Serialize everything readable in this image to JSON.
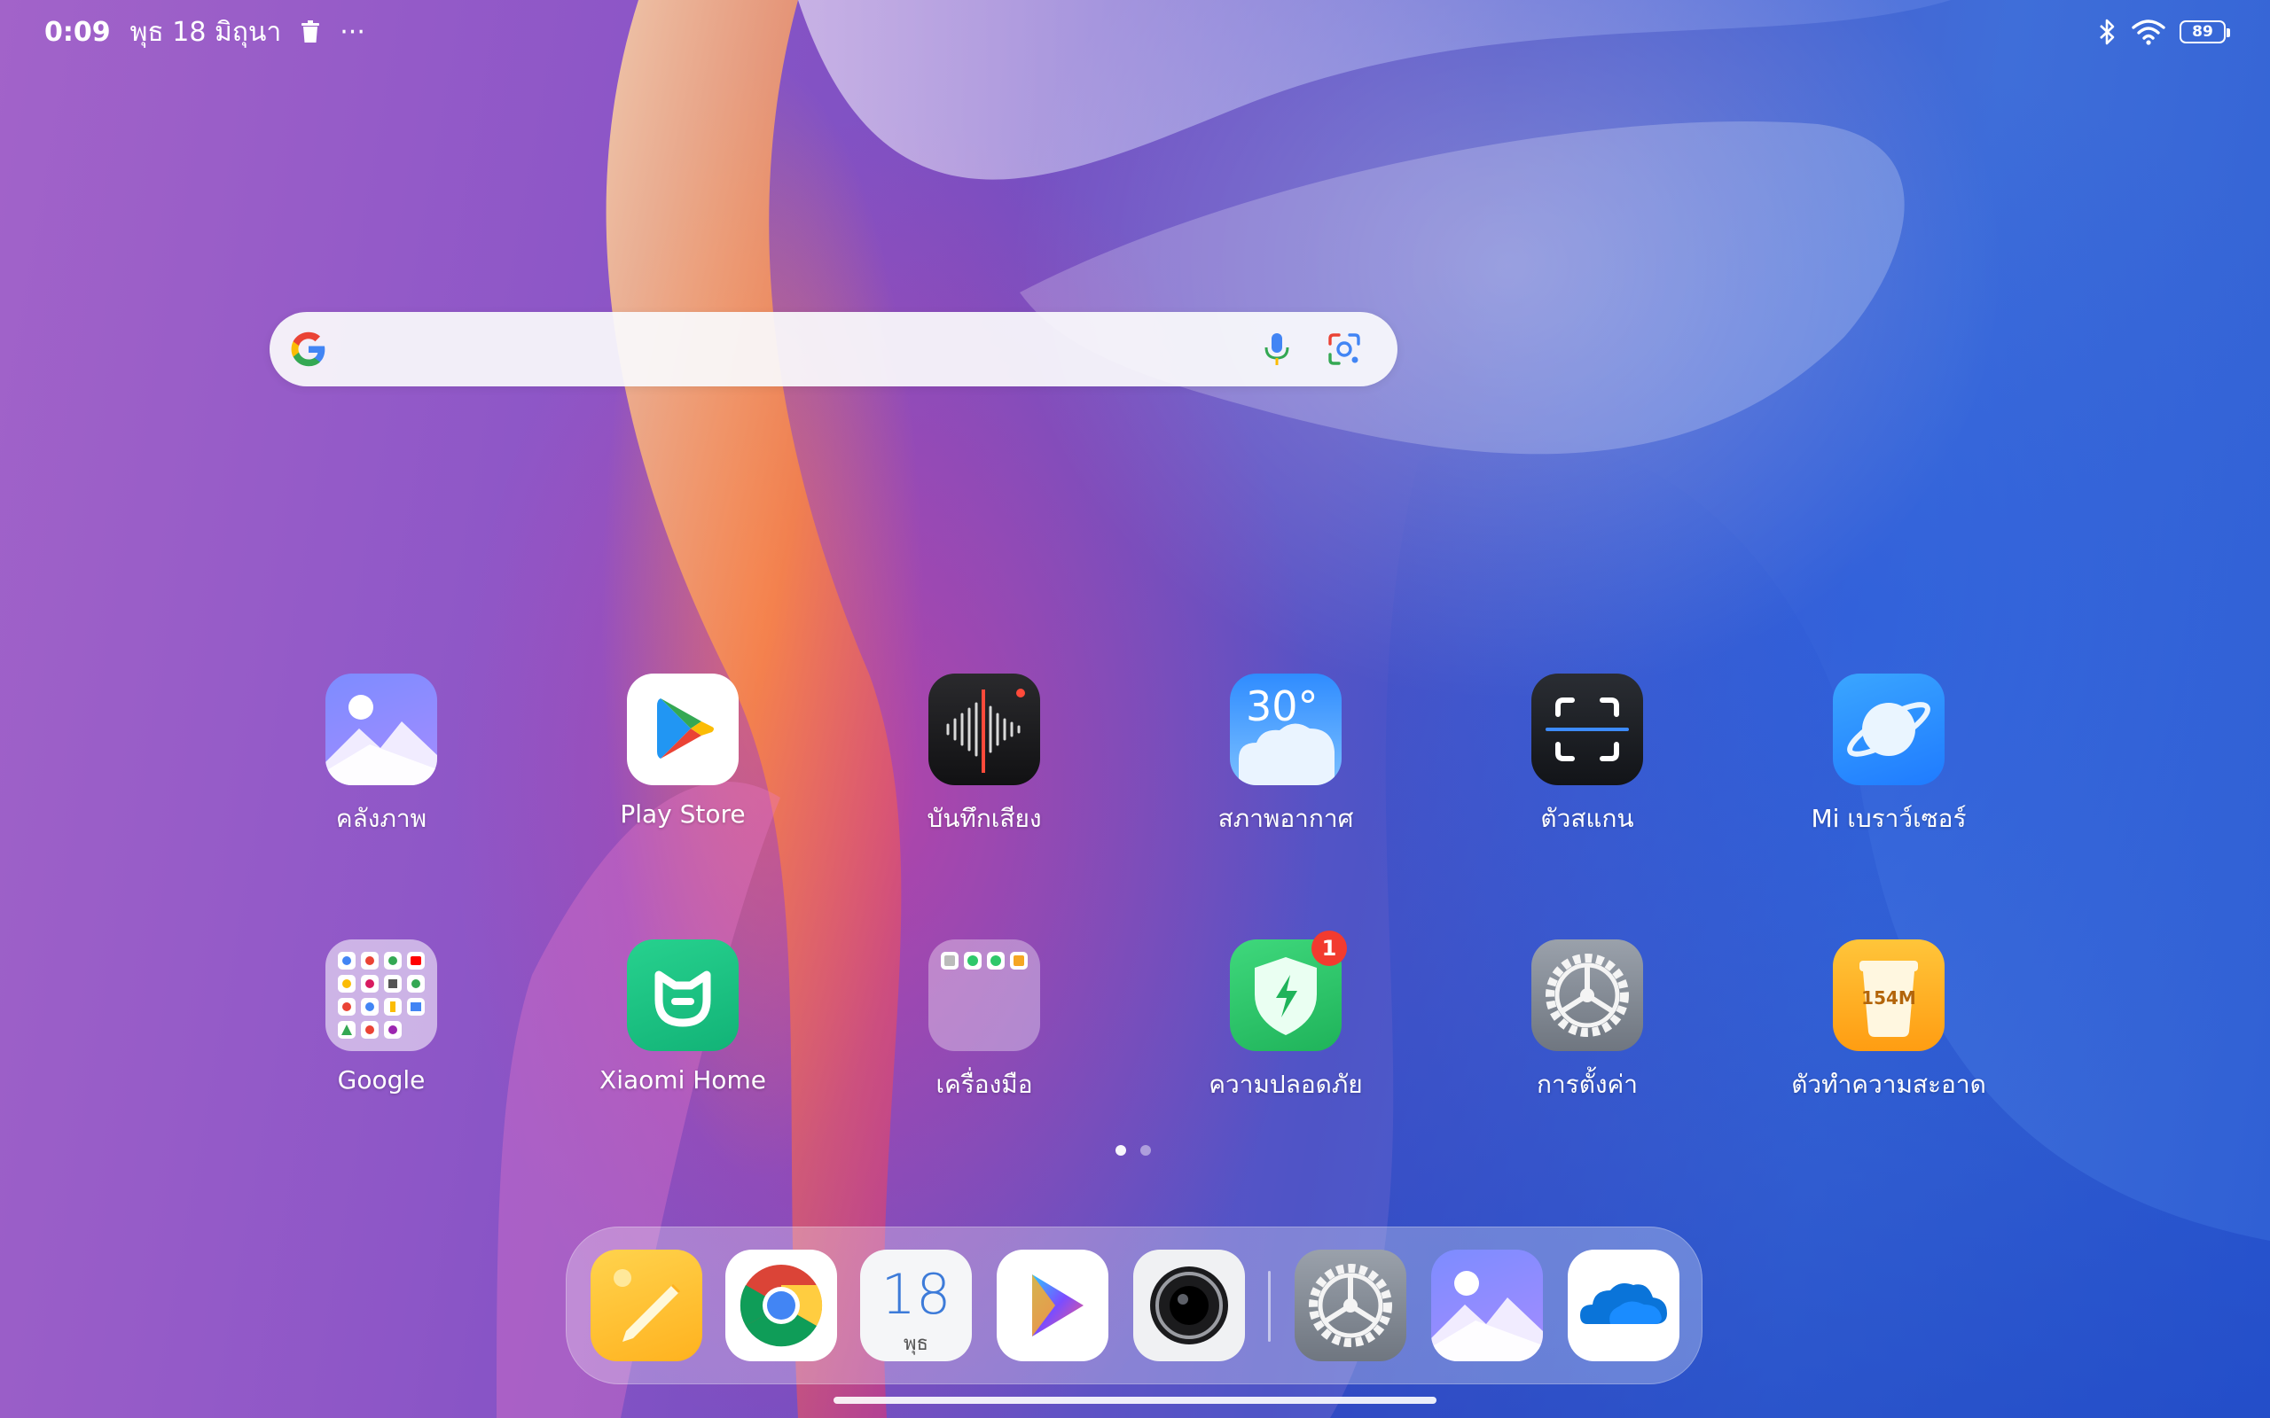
{
  "status_bar": {
    "time": "0:09",
    "date": "พุธ 18 มิถุนา",
    "trash_icon": "trash-icon",
    "more_icon": "more-icon",
    "more_text": "···",
    "battery_level": "89",
    "icons": [
      "bluetooth-icon",
      "wifi-icon",
      "battery-icon"
    ]
  },
  "search": {
    "placeholder": "",
    "icons": [
      "google-g-icon",
      "microphone-icon",
      "google-lens-icon"
    ]
  },
  "apps": [
    {
      "label": "คลังภาพ",
      "icon": "gallery-icon"
    },
    {
      "label": "Play Store",
      "icon": "play-store-icon"
    },
    {
      "label": "บันทึกเสียง",
      "icon": "sound-recorder-icon"
    },
    {
      "label": "สภาพอากาศ",
      "icon": "weather-icon",
      "icon_text": "30°"
    },
    {
      "label": "ตัวสแกน",
      "icon": "scanner-icon"
    },
    {
      "label": "Mi เบราว์เซอร์",
      "icon": "mi-browser-icon"
    },
    {
      "label": "Google",
      "icon": "google-folder-icon"
    },
    {
      "label": "Xiaomi Home",
      "icon": "xiaomi-home-icon"
    },
    {
      "label": "เครื่องมือ",
      "icon": "tools-folder-icon"
    },
    {
      "label": "ความปลอดภัย",
      "icon": "security-icon",
      "badge": "1"
    },
    {
      "label": "การตั้งค่า",
      "icon": "settings-icon"
    },
    {
      "label": "ตัวทำความสะอาด",
      "icon": "cleaner-icon",
      "icon_text": "154M"
    }
  ],
  "page_indicator": {
    "current": 1,
    "total": 2
  },
  "dock": {
    "apps": [
      {
        "name": "notes",
        "icon": "notes-icon"
      },
      {
        "name": "chrome",
        "icon": "chrome-icon"
      },
      {
        "name": "calendar",
        "icon": "calendar-icon",
        "day": "18",
        "weekday": "พุธ"
      },
      {
        "name": "mi-video",
        "icon": "video-player-icon"
      },
      {
        "name": "camera",
        "icon": "camera-icon"
      },
      {
        "name": "settings",
        "icon": "settings-icon"
      },
      {
        "name": "gallery",
        "icon": "gallery-icon"
      },
      {
        "name": "onedrive",
        "icon": "onedrive-icon"
      }
    ]
  },
  "colors": {
    "wallpaper_purple": "#8d56c7",
    "wallpaper_blue": "#3f6ed9",
    "badge_red": "#f23b2f",
    "security_green": "#2fc86a",
    "cleaner_orange": "#ffb020"
  }
}
